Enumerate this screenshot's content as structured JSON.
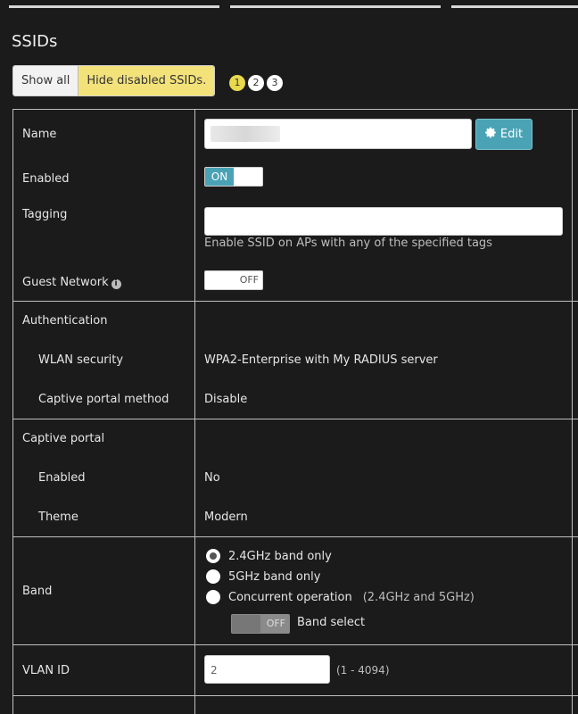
{
  "page": {
    "title": "SSIDs"
  },
  "filter": {
    "show_all": "Show all",
    "hide_disabled": "Hide disabled SSIDs."
  },
  "pagination": {
    "pages": [
      "1",
      "2",
      "3"
    ],
    "active": "1"
  },
  "rows": {
    "name": {
      "label": "Name",
      "value": "",
      "edit_label": "Edit"
    },
    "enabled": {
      "label": "Enabled",
      "toggle": "ON"
    },
    "tagging": {
      "label": "Tagging",
      "value": "",
      "hint": "Enable SSID on APs with any of the specified tags"
    },
    "guest_network": {
      "label": "Guest Network",
      "toggle": "OFF"
    },
    "authentication": {
      "label": "Authentication",
      "wlan_security_label": "WLAN security",
      "wlan_security_value": "WPA2-Enterprise with My RADIUS server",
      "captive_method_label": "Captive portal method",
      "captive_method_value": "Disable"
    },
    "captive_portal": {
      "label": "Captive portal",
      "enabled_label": "Enabled",
      "enabled_value": "No",
      "theme_label": "Theme",
      "theme_value": "Modern"
    },
    "band": {
      "label": "Band",
      "options": [
        "2.4GHz band only",
        "5GHz band only",
        "Concurrent operation"
      ],
      "concurrent_note": "(2.4GHz and 5GHz)",
      "selected": "2.4GHz band only",
      "band_select_toggle": "OFF",
      "band_select_label": "Band select"
    },
    "vlan": {
      "label": "VLAN ID",
      "value": "2",
      "range": "(1 - 4094)"
    }
  },
  "colors": {
    "accent": "#4aa3b5",
    "highlight": "#f3e27a",
    "background": "#1b1b1b"
  }
}
